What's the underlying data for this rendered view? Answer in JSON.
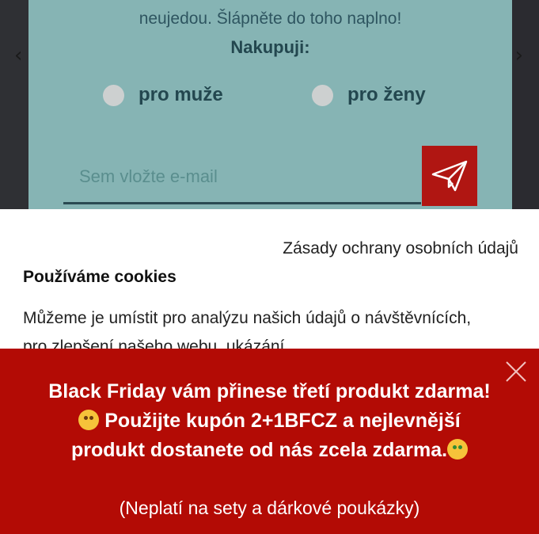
{
  "newsletter": {
    "intro_text": "neujedou. Šlápněte do toho naplno!",
    "heading": "Nakupuji:",
    "radio_men_label": "pro muže",
    "radio_women_label": "pro ženy",
    "email_placeholder": "Sem vložte e-mail",
    "send_icon": "paper-plane-icon"
  },
  "cookie": {
    "privacy_link": "Zásady ochrany osobních údajů",
    "title": "Používáme cookies",
    "body": "Můžeme je umístit pro analýzu našich údajů o návštěvnících, pro zlepšení našeho webu, ukázání"
  },
  "promo": {
    "line_part1": "Black Friday vám přinese třetí produkt zdarma!",
    "line_part2": " Použijte kupón 2+1BFCZ a nejlevnější produkt dostanete od nás zcela zdarma.",
    "note": "(Neplatí na sety a dárkové poukázky)",
    "emoji1": "zany-face-emoji",
    "emoji2": "money-mouth-face-emoji",
    "close_icon": "close-icon"
  },
  "colors": {
    "newsletter_bg": "#86b4b4",
    "accent_red": "#b01612",
    "promo_bg": "#b30b05"
  }
}
